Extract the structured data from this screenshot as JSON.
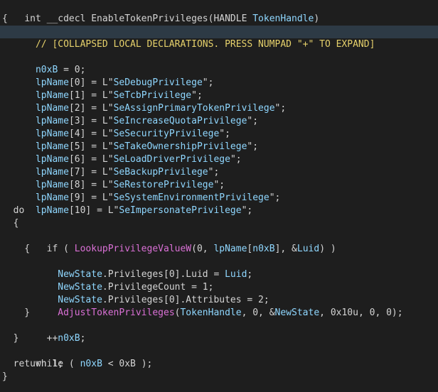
{
  "lines": [
    {
      "text": "int __cdecl EnableTokenPrivileges(HANDLE TokenHandle)"
    },
    {
      "text": "{"
    },
    {
      "text": "  // [COLLAPSED LOCAL DECLARATIONS. PRESS NUMPAD \"+\" TO EXPAND]"
    },
    {
      "text": ""
    },
    {
      "text": "  n0xB = 0;"
    },
    {
      "text": "  lpName[0] = L\"SeDebugPrivilege\";"
    },
    {
      "text": "  lpName[1] = L\"SeTcbPrivilege\";"
    },
    {
      "text": "  lpName[2] = L\"SeAssignPrimaryTokenPrivilege\";"
    },
    {
      "text": "  lpName[3] = L\"SeIncreaseQuotaPrivilege\";"
    },
    {
      "text": "  lpName[4] = L\"SeSecurityPrivilege\";"
    },
    {
      "text": "  lpName[5] = L\"SeTakeOwnershipPrivilege\";"
    },
    {
      "text": "  lpName[6] = L\"SeLoadDriverPrivilege\";"
    },
    {
      "text": "  lpName[7] = L\"SeBackupPrivilege\";"
    },
    {
      "text": "  lpName[8] = L\"SeRestorePrivilege\";"
    },
    {
      "text": "  lpName[9] = L\"SeSystemEnvironmentPrivilege\";"
    },
    {
      "text": "  lpName[10] = L\"SeImpersonatePrivilege\";"
    },
    {
      "text": "  do"
    },
    {
      "text": "  {"
    },
    {
      "text": "    if ( LookupPrivilegeValueW(0, lpName[n0xB], &Luid) )"
    },
    {
      "text": "    {"
    },
    {
      "text": "      NewState.Privileges[0].Luid = Luid;"
    },
    {
      "text": "      NewState.PrivilegeCount = 1;"
    },
    {
      "text": "      NewState.Privileges[0].Attributes = 2;"
    },
    {
      "text": "      AdjustTokenPrivileges(TokenHandle, 0, &NewState, 0x10u, 0, 0);"
    },
    {
      "text": "    }"
    },
    {
      "text": "    ++n0xB;"
    },
    {
      "text": "  }"
    },
    {
      "text": "  while ( n0xB < 0xB );"
    },
    {
      "text": "  return 1;"
    },
    {
      "text": "}"
    }
  ]
}
